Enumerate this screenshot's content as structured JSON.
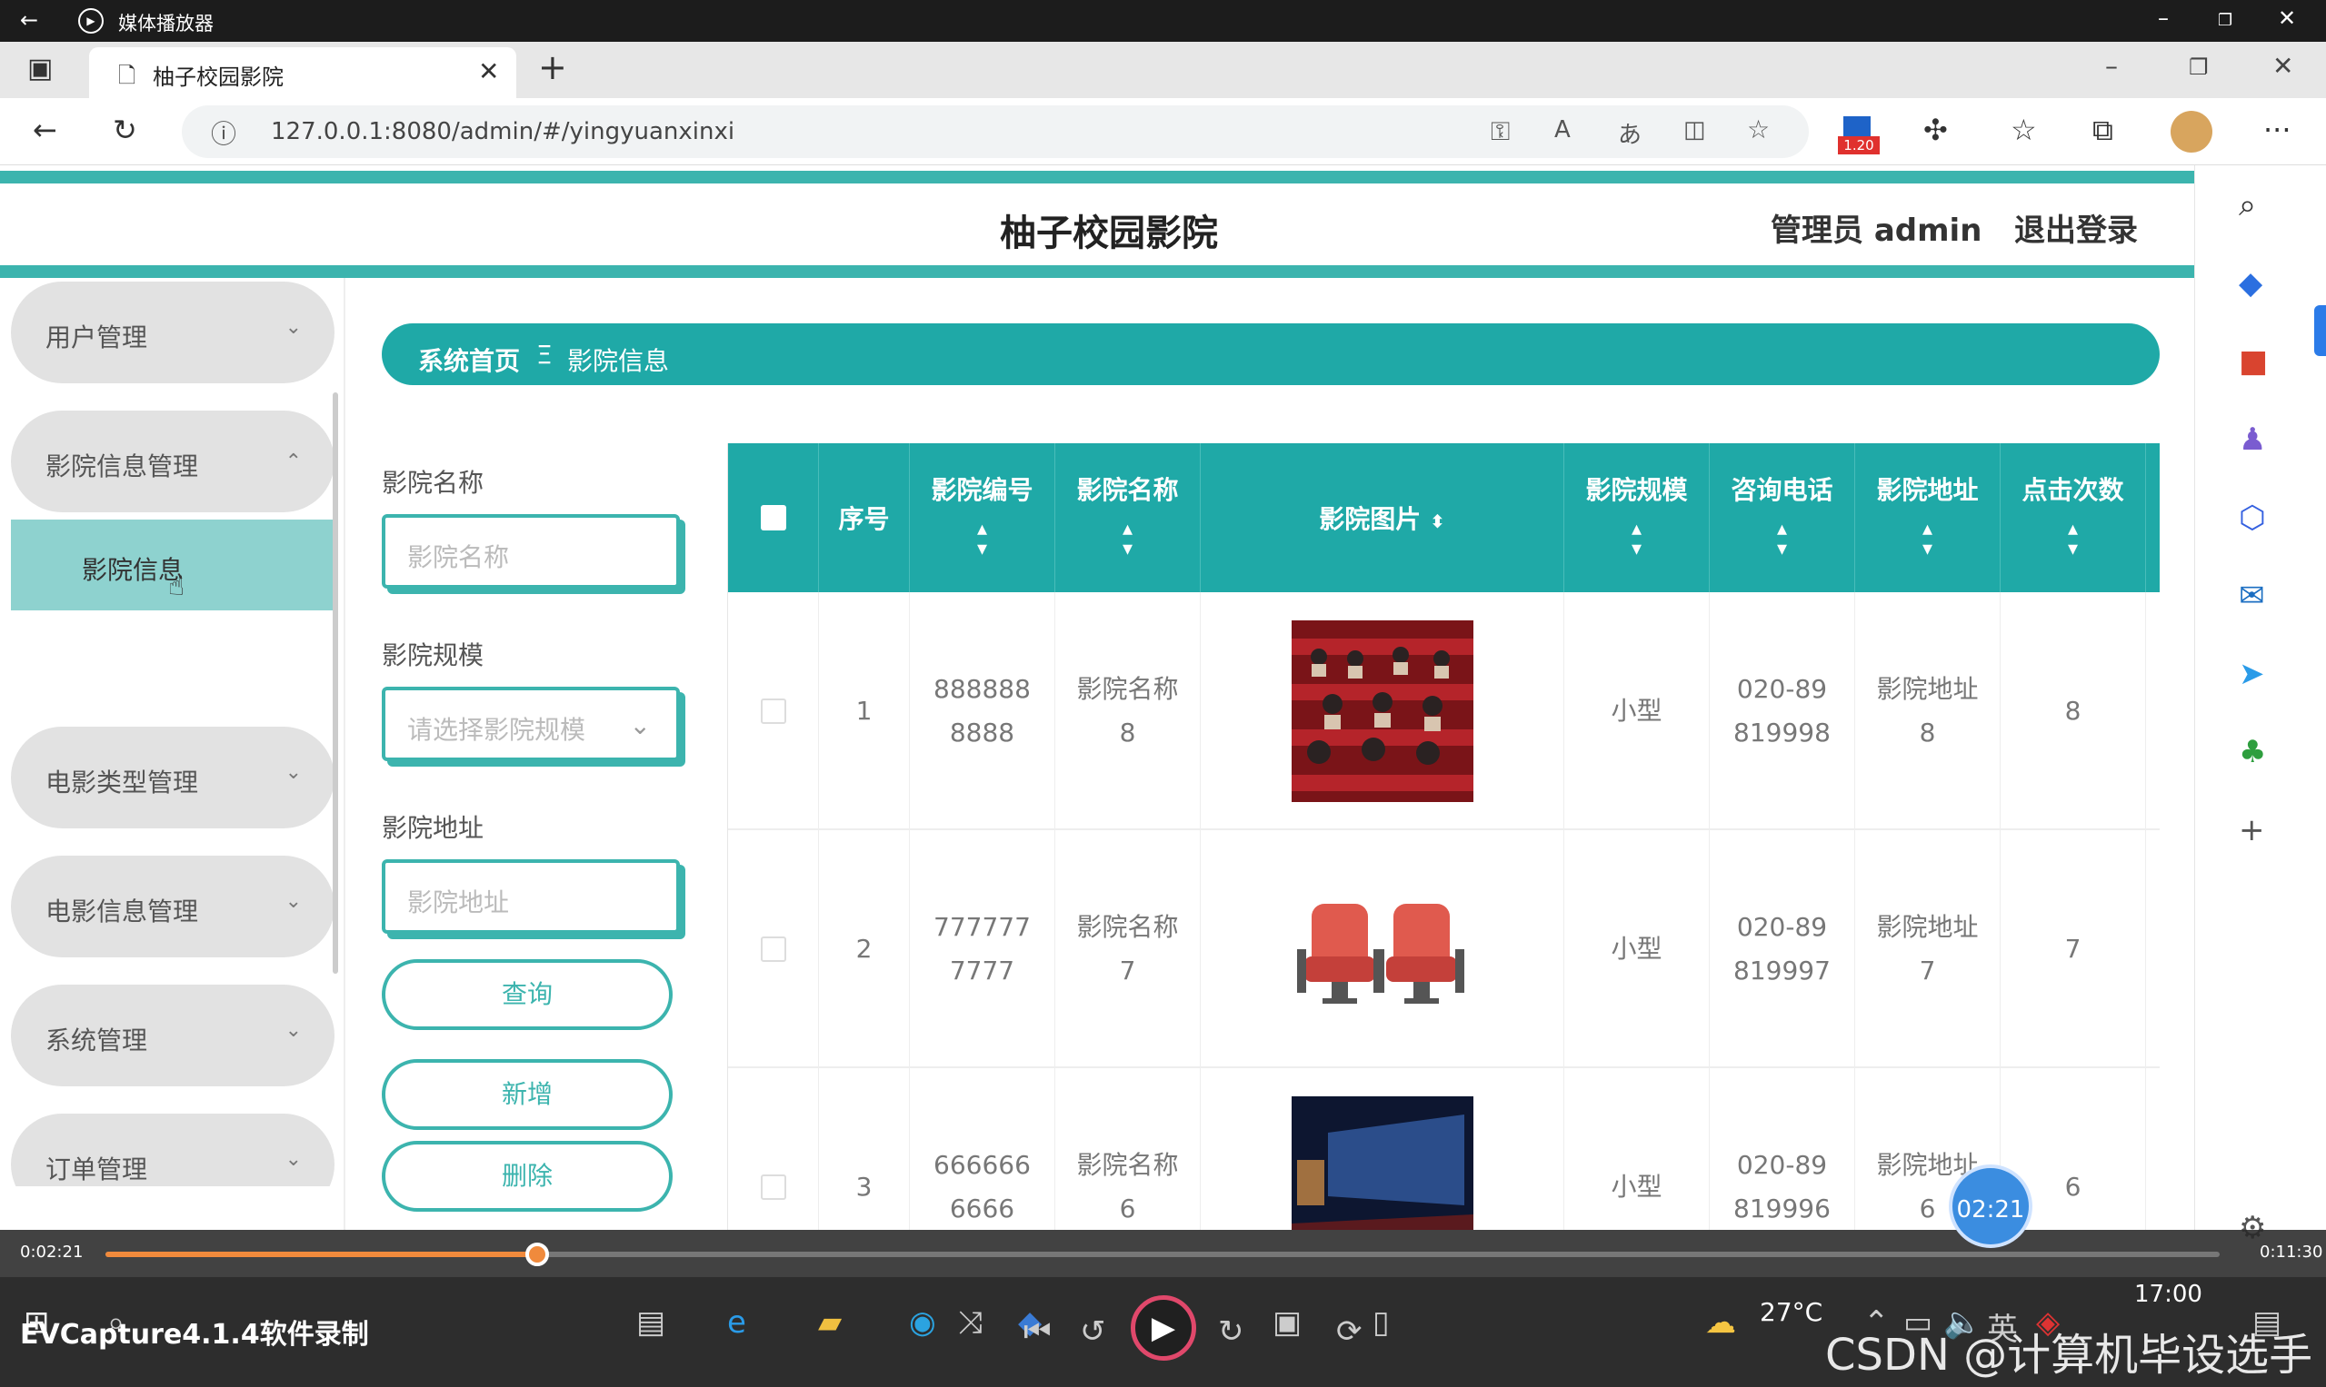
{
  "window": {
    "title": "媒体播放器"
  },
  "browser": {
    "tab_title": "柚子校园影院",
    "url": "127.0.0.1:8080/admin/#/yingyuanxinxi",
    "ext_badge": "1.20"
  },
  "header": {
    "site_title": "柚子校园影院",
    "admin_label": "管理员 admin",
    "logout": "退出登录"
  },
  "sidebar": {
    "items": [
      {
        "label": "用户管理",
        "chevron": "⌄"
      },
      {
        "label": "影院信息管理",
        "chevron": "⌃"
      },
      {
        "label": "电影类型管理",
        "chevron": "⌄"
      },
      {
        "label": "电影信息管理",
        "chevron": "⌄"
      },
      {
        "label": "系统管理",
        "chevron": "⌄"
      },
      {
        "label": "订单管理",
        "chevron": "⌄"
      }
    ],
    "sub_item": "影院信息"
  },
  "breadcrumb": {
    "home": "系统首页",
    "sep": "Ξ",
    "current": "影院信息"
  },
  "filters": {
    "name_label": "影院名称",
    "name_placeholder": "影院名称",
    "scale_label": "影院规模",
    "scale_placeholder": "请选择影院规模",
    "addr_label": "影院地址",
    "addr_placeholder": "影院地址",
    "query": "查询",
    "add": "新增",
    "delete": "删除"
  },
  "table": {
    "columns": [
      "序号",
      "影院编号",
      "影院名称",
      "影院图片",
      "影院规模",
      "咨询电话",
      "影院地址",
      "点击次数"
    ],
    "rows": [
      {
        "idx": "1",
        "code": "8888888888",
        "name": "影院名称8",
        "scale": "小型",
        "phone": "020-89819998",
        "addr": "影院地址8",
        "clicks": "8",
        "img": "audience"
      },
      {
        "idx": "2",
        "code": "7777777777",
        "name": "影院名称7",
        "scale": "小型",
        "phone": "020-89819997",
        "addr": "影院地址7",
        "clicks": "7",
        "img": "seats"
      },
      {
        "idx": "3",
        "code": "6666666666",
        "name": "影院名称6",
        "scale": "小型",
        "phone": "020-89819996",
        "addr": "影院地址6",
        "clicks": "6",
        "img": "hall"
      }
    ]
  },
  "player": {
    "current": "0:02:21",
    "total": "0:11:30",
    "bubble": "02:21",
    "progress": 0.204
  },
  "taskbar": {
    "temp": "27°C",
    "clock": "17:00"
  },
  "watermarks": {
    "recorder": "EVCapture4.1.4软件录制",
    "csdn": "CSDN @计算机毕设选手"
  },
  "colors": {
    "accent": "#1fa9a7",
    "stripe": "#3cb4ae",
    "submenu": "#8ed2cf",
    "progress": "#f08a3c"
  }
}
